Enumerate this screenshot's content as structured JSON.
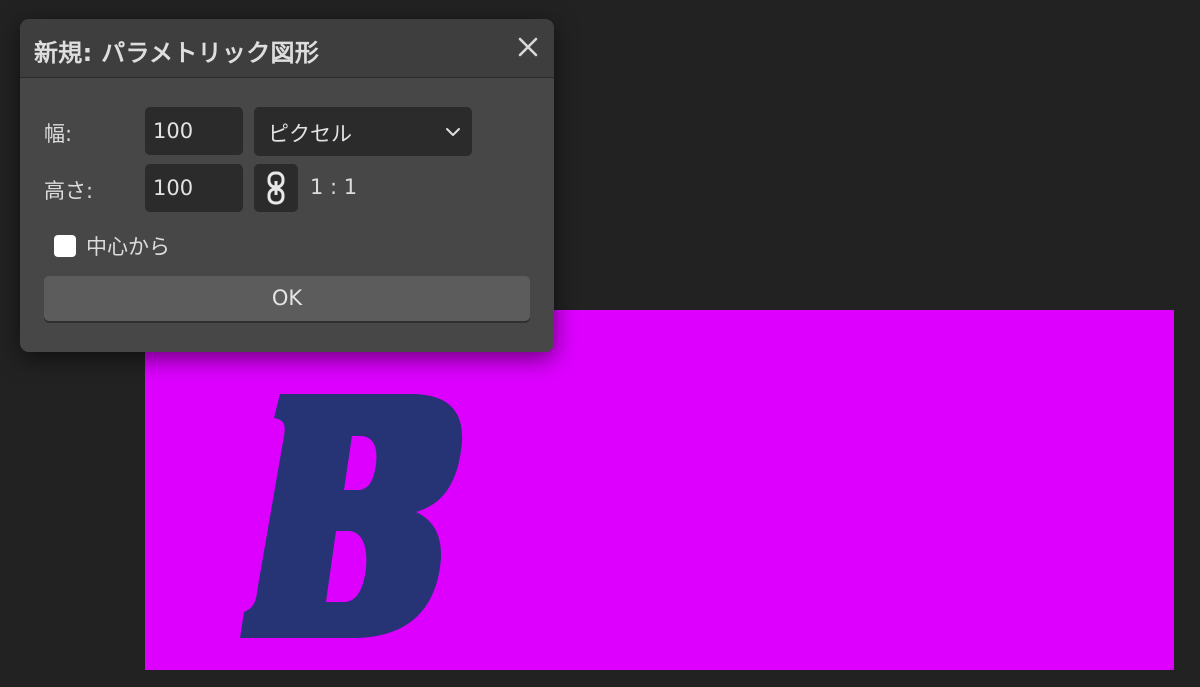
{
  "dialog": {
    "title": "新規: パラメトリック図形",
    "close_icon": "close-icon",
    "width_label": "幅:",
    "width_value": "100",
    "unit_value": "ピクセル",
    "unit_chevron_icon": "chevron-down-icon",
    "height_label": "高さ:",
    "height_value": "100",
    "link_icon": "chain-link-icon",
    "ratio_text": "1 : 1",
    "from_center_label": "中心から",
    "from_center_checked": false,
    "ok_label": "OK"
  },
  "canvas": {
    "glyph_text": "B"
  },
  "colors": {
    "app_background": "#222222",
    "dialog_background": "#474747",
    "dialog_header": "#3e3e3e",
    "input_background": "#2b2b2b",
    "ok_button": "#5c5c5c",
    "canvas_fill": "#dd00ff",
    "glyph_color": "#263475"
  }
}
